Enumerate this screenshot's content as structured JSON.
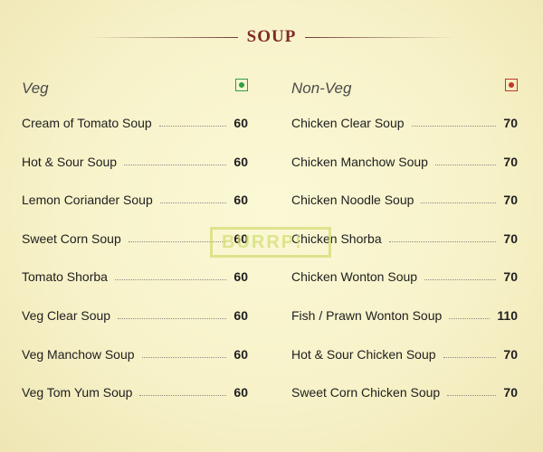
{
  "section_title": "SOUP",
  "veg": {
    "title": "Veg",
    "mark_color": "#2f9e44",
    "items": [
      {
        "name": "Cream of Tomato Soup",
        "price": "60"
      },
      {
        "name": "Hot & Sour Soup",
        "price": "60"
      },
      {
        "name": "Lemon Coriander Soup",
        "price": "60"
      },
      {
        "name": "Sweet Corn Soup",
        "price": "60"
      },
      {
        "name": "Tomato Shorba",
        "price": "60"
      },
      {
        "name": "Veg Clear Soup",
        "price": "60"
      },
      {
        "name": "Veg Manchow Soup",
        "price": "60"
      },
      {
        "name": "Veg Tom Yum Soup",
        "price": "60"
      }
    ]
  },
  "nonveg": {
    "title": "Non-Veg",
    "mark_color": "#c0392b",
    "items": [
      {
        "name": "Chicken Clear Soup",
        "price": "70"
      },
      {
        "name": "Chicken Manchow Soup",
        "price": "70"
      },
      {
        "name": "Chicken Noodle Soup",
        "price": "70"
      },
      {
        "name": "Chicken Shorba",
        "price": "70"
      },
      {
        "name": "Chicken Wonton Soup",
        "price": "70"
      },
      {
        "name": "Fish / Prawn Wonton Soup",
        "price": "110"
      },
      {
        "name": "Hot & Sour Chicken Soup",
        "price": "70"
      },
      {
        "name": "Sweet Corn Chicken Soup",
        "price": "70"
      }
    ]
  },
  "watermark": "BURRP!"
}
